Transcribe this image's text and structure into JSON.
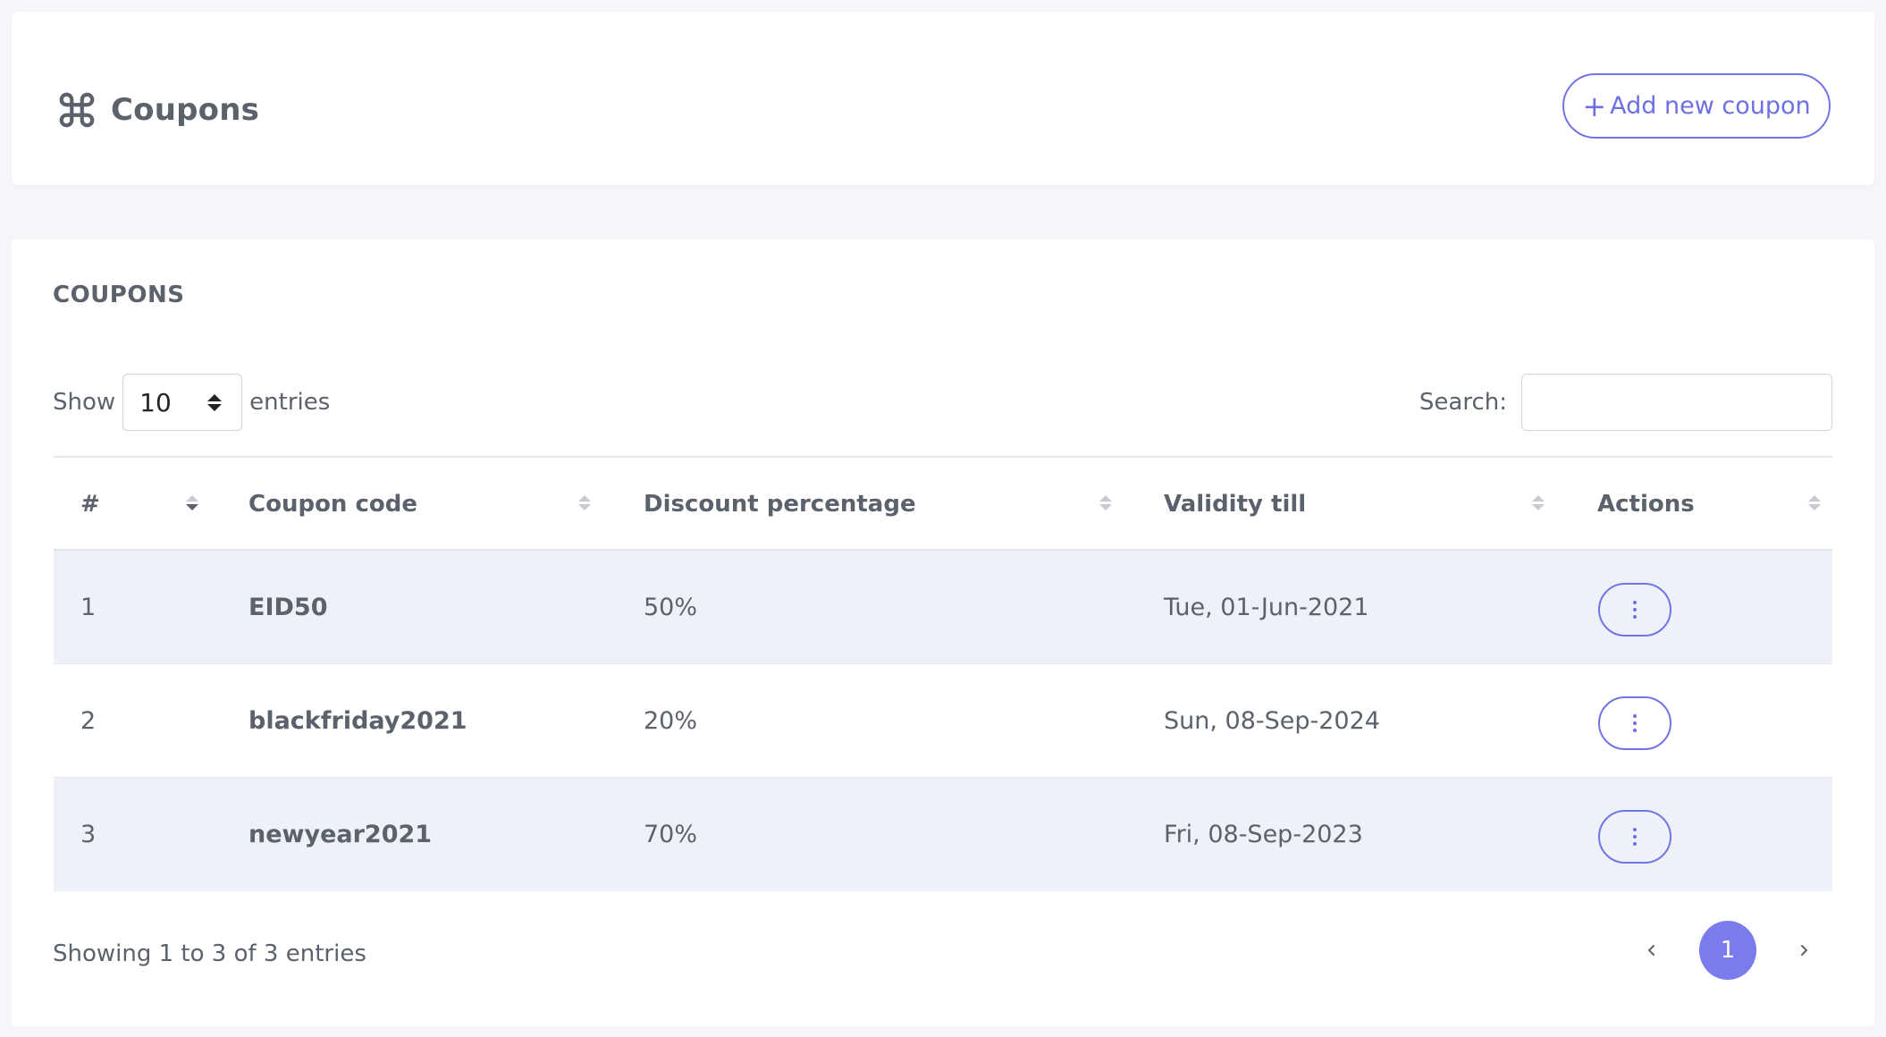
{
  "header": {
    "title": "Coupons",
    "title_icon": "command-icon",
    "add_button_plus": "+",
    "add_button_label": "Add new coupon",
    "accent_color": "#7174e6"
  },
  "card": {
    "section_title": "COUPONS",
    "show_label": "Show",
    "entries_value": "10",
    "entries_label": "entries",
    "search_label": "Search:",
    "search_value": ""
  },
  "table": {
    "columns": [
      "#",
      "Coupon code",
      "Discount percentage",
      "Validity till",
      "Actions"
    ],
    "rows": [
      {
        "index": "1",
        "code": "EID50",
        "discount": "50%",
        "validity": "Tue, 01-Jun-2021"
      },
      {
        "index": "2",
        "code": "blackfriday2021",
        "discount": "20%",
        "validity": "Sun, 08-Sep-2024"
      },
      {
        "index": "3",
        "code": "newyear2021",
        "discount": "70%",
        "validity": "Fri, 08-Sep-2023"
      }
    ]
  },
  "footer": {
    "info": "Showing 1 to 3 of 3 entries",
    "current_page": "1",
    "prev_icon": "chevron-left-icon",
    "next_icon": "chevron-right-icon"
  }
}
